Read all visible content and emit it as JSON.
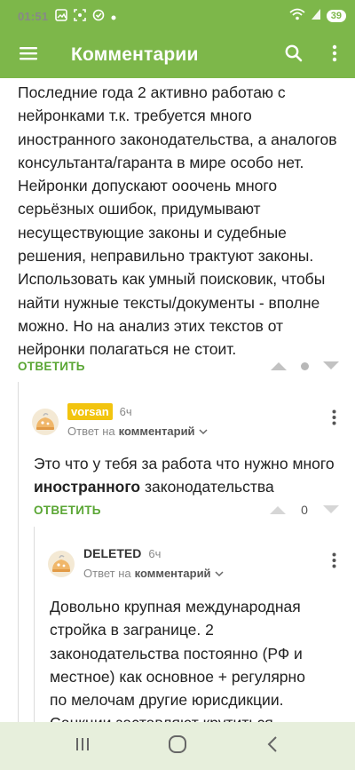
{
  "status": {
    "time": "01:51",
    "battery": "39"
  },
  "app_bar": {
    "title": "Комментарии"
  },
  "comments": [
    {
      "text": "Последние года 2 активно работаю с нейронками т.к. требуется много иностранного законодательства, а аналогов консультанта/гаранта в мире особо нет. Нейронки допускают ооочень много серьёзных ошибок, придумывают несуществующие законы и судебные решения, неправильно трактуют законы. Использовать как умный поисковик, чтобы найти нужные тексты/документы - вполне можно. Но на анализ этих текстов от нейронки полагаться не стоит.",
      "reply_label": "ОТВЕТИТЬ"
    },
    {
      "author": "vorsan",
      "time": "6ч",
      "reply_to_prefix": "Ответ на",
      "reply_to_target": "комментарий",
      "text_before": "Это что у тебя за работа что нужно много ",
      "text_bold": "иностранного",
      "text_after": " законодательства",
      "reply_label": "ОТВЕТИТЬ",
      "score": "0"
    },
    {
      "author": "DELETED",
      "time": "6ч",
      "reply_to_prefix": "Ответ на",
      "reply_to_target": "комментарий",
      "text": "Довольно крупная международная стройка в загранице. 2 законодательства постоянно (РФ и местное) как основное + регулярно по мелочам другие юрисдикции. Санкции заставляют крутиться."
    }
  ],
  "colors": {
    "accent": "#7db74a",
    "reply": "#5aa634",
    "badge": "#f2c40f"
  }
}
